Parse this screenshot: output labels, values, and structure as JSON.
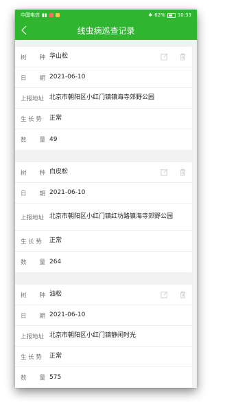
{
  "status": {
    "carrier": "中国电信",
    "battery": "62%",
    "time": "10:33"
  },
  "header": {
    "title": "线虫病巡查记录",
    "back_icon": "chevron-left-icon"
  },
  "labels": {
    "tree": [
      "树",
      "种"
    ],
    "date": [
      "日",
      "期"
    ],
    "address": "上报地址",
    "growth": "生 长 势",
    "count": [
      "数",
      "量"
    ]
  },
  "records": [
    {
      "species": "华山松",
      "date": "2021-06-10",
      "address": "北京市朝阳区小红门镇镇海寺郊野公园",
      "growth": "正常",
      "count": "49"
    },
    {
      "species": "白皮松",
      "date": "2021-06-10",
      "address": "北京市朝阳区小红门镇红坊路镇海寺郊野公园",
      "growth": "正常",
      "count": "264"
    },
    {
      "species": "油松",
      "date": "2021-06-10",
      "address": "北京市朝阳区小红门镇静闲时光",
      "growth": "正常",
      "count": "575"
    }
  ],
  "colors": {
    "brand_green": "#2fb52f",
    "icon_grey": "#cccccc"
  }
}
